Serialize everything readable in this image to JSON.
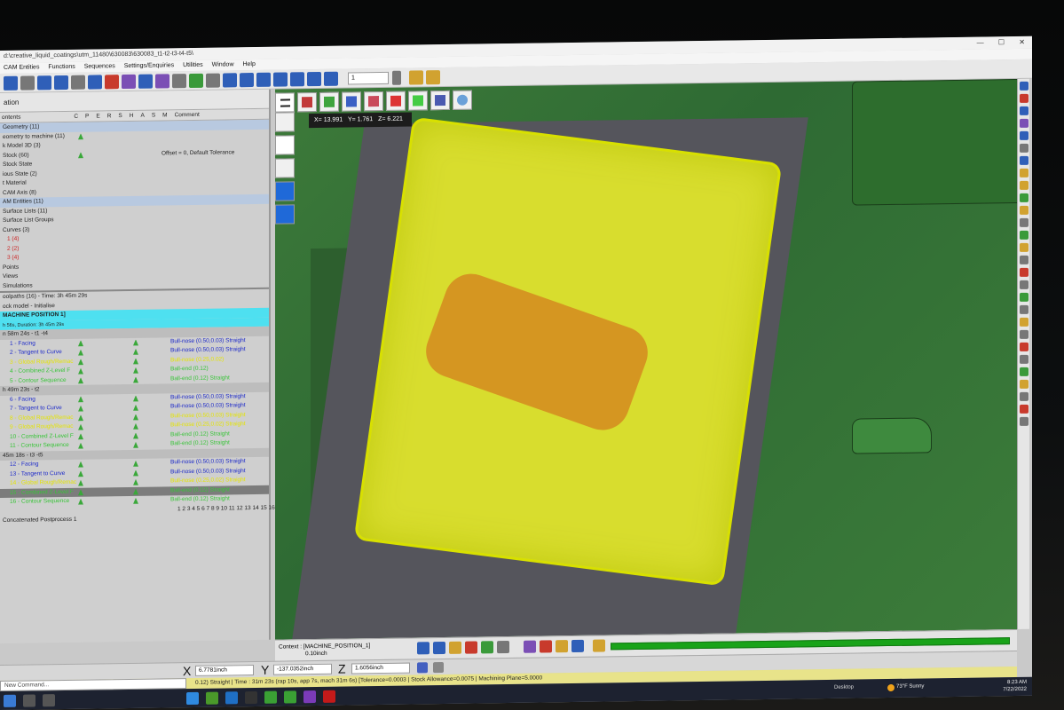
{
  "window": {
    "title_path": "d:\\creative_liquid_coatings\\utm_11480\\630083\\630083_t1-t2-t3-t4-t5\\"
  },
  "menu": [
    "CAM Entities",
    "Functions",
    "Sequences",
    "Settings/Enquiries",
    "Utilities",
    "Window",
    "Help"
  ],
  "toolbar": {
    "combo_value": "1"
  },
  "left_panel": {
    "header": "ation",
    "columns": [
      "ontents",
      "C",
      "P",
      "E",
      "R",
      "S",
      "H",
      "A",
      "S",
      "M",
      "Comment"
    ],
    "tree": [
      "Geometry (11)",
      "eometry to machine (11)",
      "k Model 3D (3)",
      "Stock (60)",
      "Stock State",
      "ious State (2)",
      "t Material",
      "CAM Axis (8)",
      "AM Entities (11)",
      "Surface Lists (11)",
      "Surface List Groups",
      "Curves (3)",
      "1 (4)",
      "2 (2)",
      "3 (4)",
      "Points",
      "Views",
      "Simulations",
      "oolpaths (16) - Time: 3h 45m 29s",
      "ock model - Initialise"
    ],
    "offset_comment": "Offset = 0, Default Tolerance",
    "machine_position": "MACHINE POSITION 1]",
    "machine_sub": "h 56s, Duration: 3h 45m 29s",
    "group1_head": "n 58m 24s - t1 -t4",
    "group1": [
      {
        "name": "1 - Facing",
        "tool": "Bull-nose (0.50,0.03) Straight",
        "color": "blue"
      },
      {
        "name": "2 - Tangent to Curve",
        "tool": "Bull-nose (0.50,0.03) Straight",
        "color": "blue"
      },
      {
        "name": "3 - Global Rough/Remac",
        "tool": "Bull-nose (0.25,0.02)",
        "color": "yel"
      },
      {
        "name": "4 - Combined Z-Level F",
        "tool": "Ball-end (0.12)",
        "color": "grn"
      },
      {
        "name": "5 - Contour Sequence",
        "tool": "Ball-end (0.12) Straight",
        "color": "grn"
      }
    ],
    "group2_head": "h 49m 23s - t2",
    "group2": [
      {
        "name": "6 - Facing",
        "tool": "Bull-nose (0.50,0.03) Straight",
        "color": "blue"
      },
      {
        "name": "7 - Tangent to Curve",
        "tool": "Bull-nose (0.50,0.03) Straight",
        "color": "blue"
      },
      {
        "name": "8 - Global Rough/Remac",
        "tool": "Bull-nose (0.50,0.03) Straight",
        "color": "yel"
      },
      {
        "name": "9 - Global Rough/Remac",
        "tool": "Bull-nose (0.25,0.02) Straight",
        "color": "yel"
      },
      {
        "name": "10 - Combined Z-Level F",
        "tool": "Ball-end (0.12) Straight",
        "color": "grn"
      },
      {
        "name": "11 - Contour Sequence",
        "tool": "Ball-end (0.12) Straight",
        "color": "grn"
      }
    ],
    "group3_head": "45m 18s - t3 -t5",
    "group3": [
      {
        "name": "12 - Facing",
        "tool": "Bull-nose (0.50,0.03) Straight",
        "color": "blue"
      },
      {
        "name": "13 - Tangent to Curve",
        "tool": "Bull-nose (0.50,0.03) Straight",
        "color": "blue"
      },
      {
        "name": "14 - Global Rough/Remac",
        "tool": "Bull-nose (0.25,0.02) Straight",
        "color": "yel"
      },
      {
        "name": "15 - Combined Z-Level F",
        "tool": "Ball-end (0.12) Straight",
        "color": "grn"
      },
      {
        "name": "16 - Contour Sequence",
        "tool": "Ball-end (0.12) Straight",
        "color": "grn"
      }
    ],
    "numbers_row": "1 2 3 4 5 6 7 8 9 10 11 12 13 14 15 16",
    "postprocess": "Concatenated Postprocess 1"
  },
  "viewport": {
    "coords": {
      "x": "X= 13.991",
      "y": "Y= 1.761",
      "z": "Z= 6.221"
    },
    "context": "Context : [MACHINE_POSITION_1]",
    "scale": "0.10inch"
  },
  "coordbar": {
    "x_label": "X",
    "x_value": "6.7781inch",
    "y_label": "Y",
    "y_value": "-137.0352inch",
    "z_label": "Z",
    "z_value": "1.6056inch"
  },
  "command": {
    "placeholder": "New Command..."
  },
  "status": "0.12) Straight | Time : 31m 23s (rap 10s, app 7s, mach 31m 6s) [Tolerance=0.0003 | Stock Allowance=0.0075 | Machining Plane=5.0000",
  "taskbar": {
    "desktop": "Desktop",
    "weather": "73°F  Sunny",
    "time": "8:23 AM",
    "date": "7/22/2022"
  },
  "colors": {
    "toolpath": "#e8ef28",
    "viewport_bg": "#3d7a3a",
    "selected_row": "#4ee0f0",
    "progress": "#19a319"
  }
}
